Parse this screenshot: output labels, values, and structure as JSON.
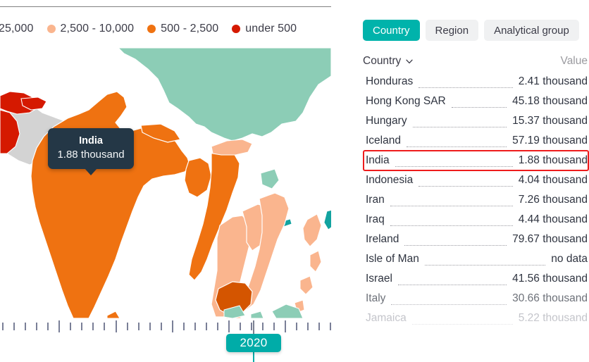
{
  "legend": {
    "items": [
      {
        "label": "25,000",
        "color": "#ffffff",
        "dot": false
      },
      {
        "label": "2,500 - 10,000",
        "color": "#fab58e",
        "dot": true
      },
      {
        "label": "500 - 2,500",
        "color": "#ef7211",
        "dot": true
      },
      {
        "label": "under 500",
        "color": "#d51900",
        "dot": true
      }
    ]
  },
  "tooltip": {
    "title": "India",
    "value": "1.88 thousand"
  },
  "timeline": {
    "year": "2020"
  },
  "panel": {
    "tabs": [
      {
        "label": "Country",
        "active": true
      },
      {
        "label": "Region",
        "active": false
      },
      {
        "label": "Analytical group",
        "active": false
      }
    ],
    "columns": {
      "country": "Country",
      "value": "Value",
      "sort_icon": "chevron-down-icon"
    },
    "rows": [
      {
        "name": "Honduras",
        "value": "2.41 thousand",
        "state": "normal",
        "highlighted": false
      },
      {
        "name": "Hong Kong SAR",
        "value": "45.18 thousand",
        "state": "normal",
        "highlighted": false
      },
      {
        "name": "Hungary",
        "value": "15.37 thousand",
        "state": "normal",
        "highlighted": false
      },
      {
        "name": "Iceland",
        "value": "57.19 thousand",
        "state": "normal",
        "highlighted": false
      },
      {
        "name": "India",
        "value": "1.88 thousand",
        "state": "normal",
        "highlighted": true
      },
      {
        "name": "Indonesia",
        "value": "4.04 thousand",
        "state": "normal",
        "highlighted": false
      },
      {
        "name": "Iran",
        "value": "7.26 thousand",
        "state": "normal",
        "highlighted": false
      },
      {
        "name": "Iraq",
        "value": "4.44 thousand",
        "state": "normal",
        "highlighted": false
      },
      {
        "name": "Ireland",
        "value": "79.67 thousand",
        "state": "normal",
        "highlighted": false
      },
      {
        "name": "Isle of Man",
        "value": "no data",
        "state": "normal",
        "highlighted": false
      },
      {
        "name": "Israel",
        "value": "41.56 thousand",
        "state": "normal",
        "highlighted": false
      },
      {
        "name": "Italy",
        "value": "30.66 thousand",
        "state": "fade1",
        "highlighted": false
      },
      {
        "name": "Jamaica",
        "value": "5.22 thousand",
        "state": "fade2",
        "highlighted": false
      }
    ]
  },
  "colors": {
    "accent_teal": "#00b3ab",
    "highlight_red": "#ee1c1c",
    "tooltip_bg": "#243746",
    "map_orange": "#ef7211",
    "map_dark_orange": "#d45500",
    "map_peach": "#fab58e",
    "map_red": "#d51900",
    "map_teal": "#8ccdb6",
    "map_deep_teal": "#12a3a0",
    "map_grey": "#d3d3d3"
  }
}
